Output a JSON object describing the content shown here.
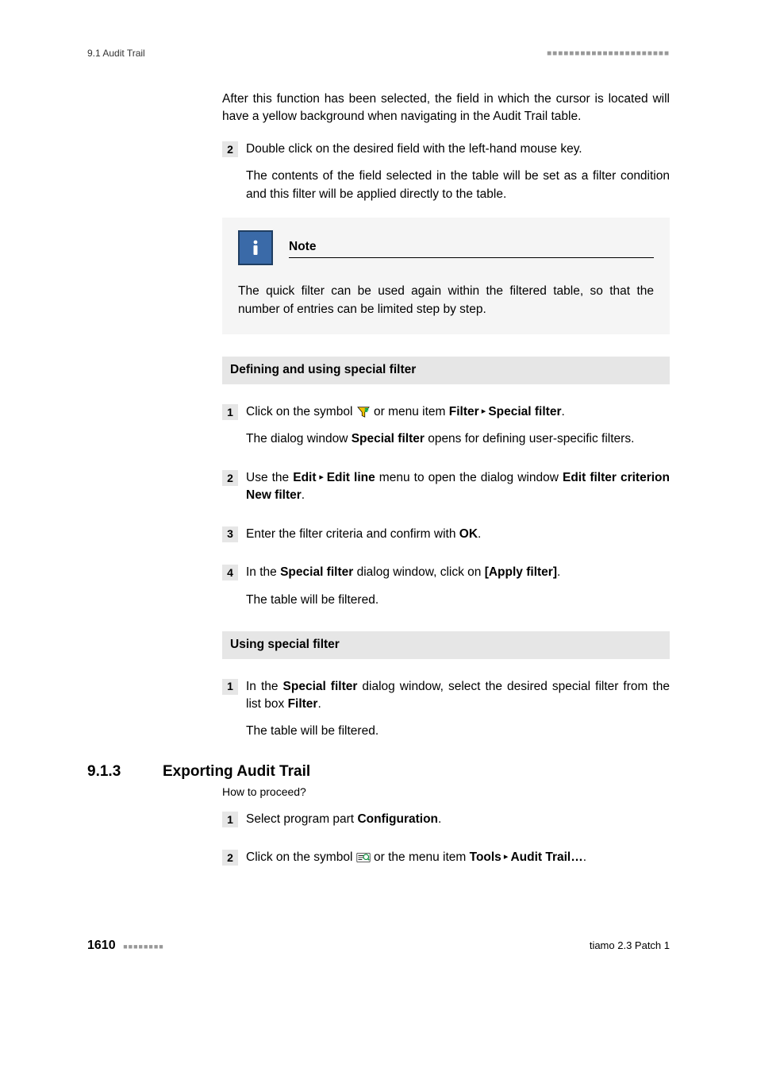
{
  "header": {
    "left": "9.1 Audit Trail",
    "right": "■■■■■■■■■■■■■■■■■■■■■■"
  },
  "intro_para": "After this function has been selected, the field in which the cursor is located will have a yellow background when navigating in the Audit Trail table.",
  "quick_step2": {
    "num": "2",
    "line1": "Double click on the desired field with the left-hand mouse key.",
    "line2": "The contents of the field selected in the table will be set as a filter condition and this filter will be applied directly to the table."
  },
  "note": {
    "title": "Note",
    "body": "The quick filter can be used again within the filtered table, so that the number of entries can be limited step by step."
  },
  "sec_define": {
    "title": "Defining and using special filter",
    "s1": {
      "num": "1",
      "pre": "Click on the symbol ",
      "mid": " or menu item ",
      "b1": "Filter",
      "arrow": " ▸ ",
      "b2": "Special filter",
      "end": ".",
      "p2a": "The dialog window ",
      "p2b": "Special filter",
      "p2c": " opens for defining user-specific filters."
    },
    "s2": {
      "num": "2",
      "a": "Use the ",
      "b1": "Edit",
      "arrow": " ▸ ",
      "b2": "Edit line",
      "c": " menu to open the dialog window ",
      "b3": "Edit filter criterion New filter",
      "d": "."
    },
    "s3": {
      "num": "3",
      "a": "Enter the filter criteria and confirm with ",
      "b1": "OK",
      "b": "."
    },
    "s4": {
      "num": "4",
      "a": "In the ",
      "b1": "Special filter",
      "b": " dialog window, click on ",
      "b2": "[Apply filter]",
      "c": ".",
      "p2": "The table will be filtered."
    }
  },
  "sec_use": {
    "title": "Using special filter",
    "s1": {
      "num": "1",
      "a": "In the ",
      "b1": "Special filter",
      "b": " dialog window, select the desired special filter from the list box ",
      "b2": "Filter",
      "c": ".",
      "p2": "The table will be filtered."
    }
  },
  "export": {
    "num": "9.1.3",
    "title": "Exporting Audit Trail",
    "proceed": "How to proceed?",
    "s1": {
      "num": "1",
      "a": "Select program part ",
      "b1": "Configuration",
      "b": "."
    },
    "s2": {
      "num": "2",
      "a": "Click on the symbol ",
      "b": " or the menu item ",
      "b1": "Tools",
      "arrow": " ▸ ",
      "b2": "Audit Trail…",
      "c": "."
    }
  },
  "footer": {
    "page": "1610",
    "sq": "■■■■■■■■",
    "right": "tiamo 2.3 Patch 1"
  }
}
